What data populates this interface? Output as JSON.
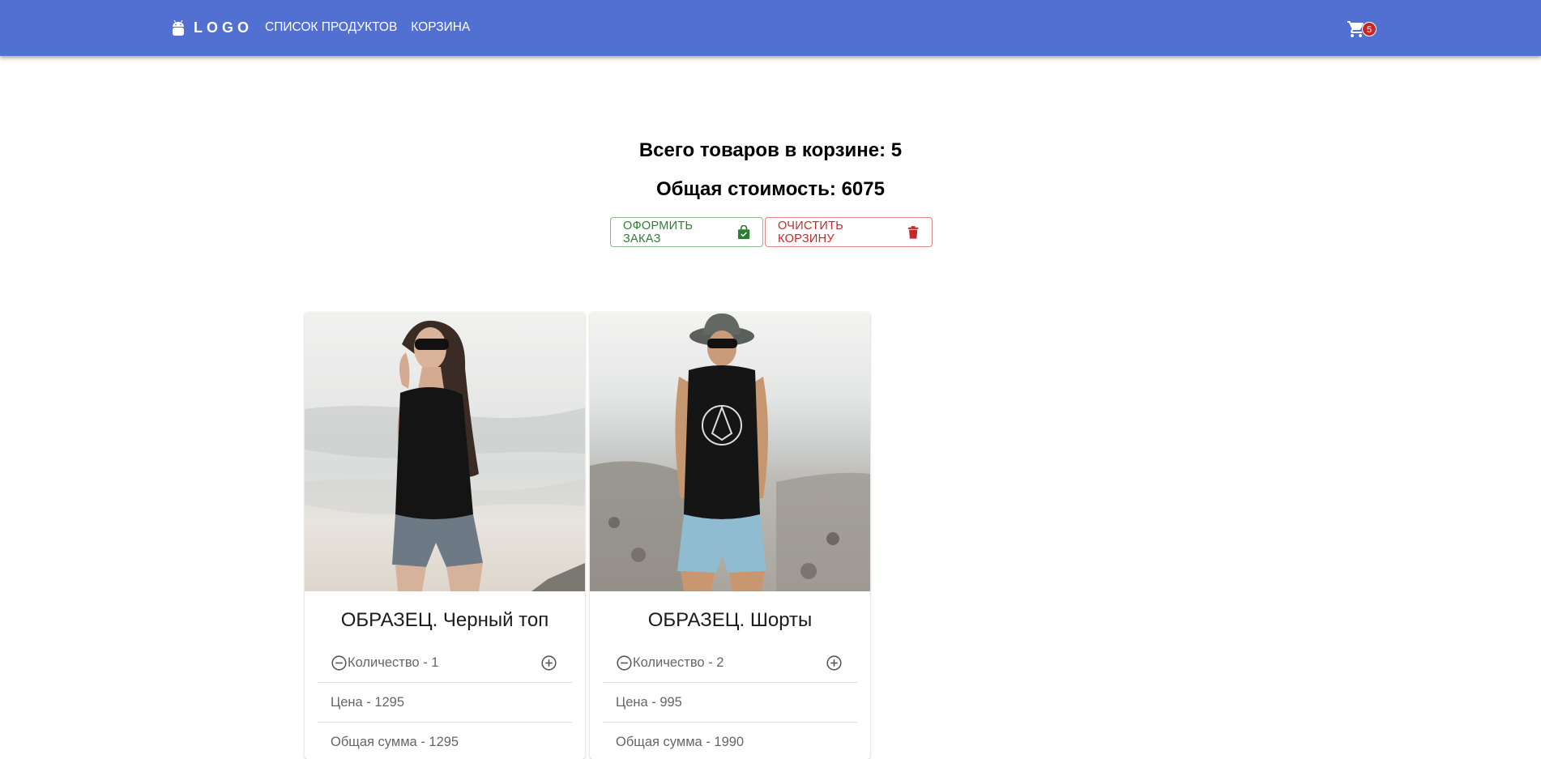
{
  "header": {
    "logo_text": "LOGO",
    "logo_icon": "android-icon",
    "nav": [
      {
        "label": "СПИСОК ПРОДУКТОВ"
      },
      {
        "label": "КОРЗИНА"
      }
    ],
    "cart_icon": "cart-icon",
    "cart_count": "5",
    "colors": {
      "bar": "#5170d1",
      "badge": "#c62828"
    }
  },
  "summary": {
    "total_items": "Всего товаров в корзине: 5",
    "total_cost": "Общая стоимость: 6075"
  },
  "actions": {
    "order_label": "ОФОРМИТЬ ЗАКАЗ",
    "order_icon": "shopping-bag-icon",
    "order_color": "#2e7d32",
    "clear_label": "ОЧИСТИТЬ КОРЗИНУ",
    "clear_icon": "trash-icon",
    "clear_color": "#c62828"
  },
  "products": [
    {
      "title": "ОБРАЗЕЦ. Черный топ",
      "quantity": "Количество - 1",
      "price": "Цена - 1295",
      "total": "Общая сумма - 1295"
    },
    {
      "title": "ОБРАЗЕЦ. Шорты",
      "quantity": "Количество - 2",
      "price": "Цена - 995",
      "total": "Общая сумма - 1990"
    }
  ]
}
